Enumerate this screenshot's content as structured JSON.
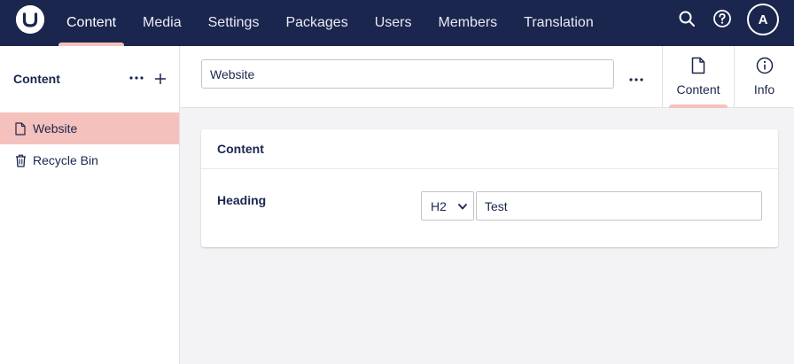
{
  "topbar": {
    "nav": [
      {
        "label": "Content",
        "active": true
      },
      {
        "label": "Media",
        "active": false
      },
      {
        "label": "Settings",
        "active": false
      },
      {
        "label": "Packages",
        "active": false
      },
      {
        "label": "Users",
        "active": false
      },
      {
        "label": "Members",
        "active": false
      },
      {
        "label": "Translation",
        "active": false
      }
    ],
    "avatar_initial": "A",
    "icons": [
      "umbraco-logo-icon",
      "search-icon",
      "help-icon"
    ]
  },
  "sidebar": {
    "title": "Content",
    "items": [
      {
        "label": "Website",
        "icon": "document-icon",
        "selected": true
      },
      {
        "label": "Recycle Bin",
        "icon": "trash-icon",
        "selected": false
      }
    ]
  },
  "header": {
    "name_value": "Website",
    "apps": [
      {
        "label": "Content",
        "icon": "document-icon",
        "active": true
      },
      {
        "label": "Info",
        "icon": "info-icon",
        "active": false
      }
    ]
  },
  "panel": {
    "title": "Content",
    "property_label": "Heading",
    "heading_level": "H2",
    "heading_text": "Test"
  },
  "colors": {
    "topbar_bg": "#1b264f",
    "accent": "#f5c1bc",
    "background": "#f3f3f5"
  }
}
